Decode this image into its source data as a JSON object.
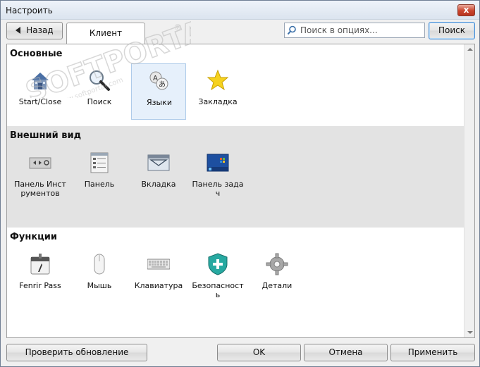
{
  "window": {
    "title": "Настроить",
    "close_label": "x"
  },
  "toolbar": {
    "back_label": "Назад",
    "tab_label": "Клиент",
    "search_placeholder": "Поиск в опциях...",
    "search_button": "Поиск"
  },
  "watermark": {
    "text": "SOFTPORTAL",
    "subtext": "www.softportal.com",
    "mark": "®"
  },
  "sections": [
    {
      "title": "Основные",
      "items": [
        {
          "label": "Start/Close",
          "icon": "house-icon"
        },
        {
          "label": "Поиск",
          "icon": "magnifier-icon"
        },
        {
          "label": "Языки",
          "icon": "languages-icon"
        },
        {
          "label": "Закладка",
          "icon": "star-icon"
        }
      ]
    },
    {
      "title": "Внешний вид",
      "items": [
        {
          "label": "Панель Инструментов",
          "icon": "toolbar-icon"
        },
        {
          "label": "Панель",
          "icon": "panel-icon"
        },
        {
          "label": "Вкладка",
          "icon": "tab-icon"
        },
        {
          "label": "Панель задач",
          "icon": "taskbar-icon"
        }
      ]
    },
    {
      "title": "Функции",
      "items": [
        {
          "label": "Fenrir Pass",
          "icon": "fenrir-pass-icon"
        },
        {
          "label": "Мышь",
          "icon": "mouse-icon"
        },
        {
          "label": "Клавиатура",
          "icon": "keyboard-icon"
        },
        {
          "label": "Безопасность",
          "icon": "shield-icon"
        },
        {
          "label": "Детали",
          "icon": "gear-icon"
        }
      ]
    }
  ],
  "footer": {
    "update_label": "Проверить обновление",
    "ok_label": "OK",
    "cancel_label": "Отмена",
    "apply_label": "Применить"
  }
}
